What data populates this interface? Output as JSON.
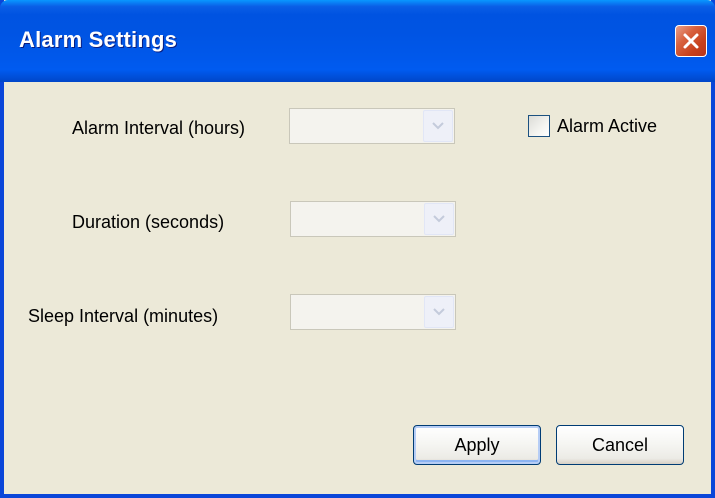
{
  "window": {
    "title": "Alarm Settings"
  },
  "fields": [
    {
      "label": "Alarm Interval (hours)",
      "value": ""
    },
    {
      "label": "Duration (seconds)",
      "value": ""
    },
    {
      "label": "Sleep Interval (minutes)",
      "value": ""
    }
  ],
  "alarm_active": {
    "label": "Alarm Active",
    "checked": false
  },
  "buttons": {
    "apply_label": "Apply",
    "cancel_label": "Cancel"
  },
  "icons": {
    "close": "close-icon",
    "dropdown": "chevron-down-icon"
  },
  "colors": {
    "title_bar": "#0054E3",
    "close_button": "#C7401C",
    "dialog_background": "#ECE9D8"
  }
}
